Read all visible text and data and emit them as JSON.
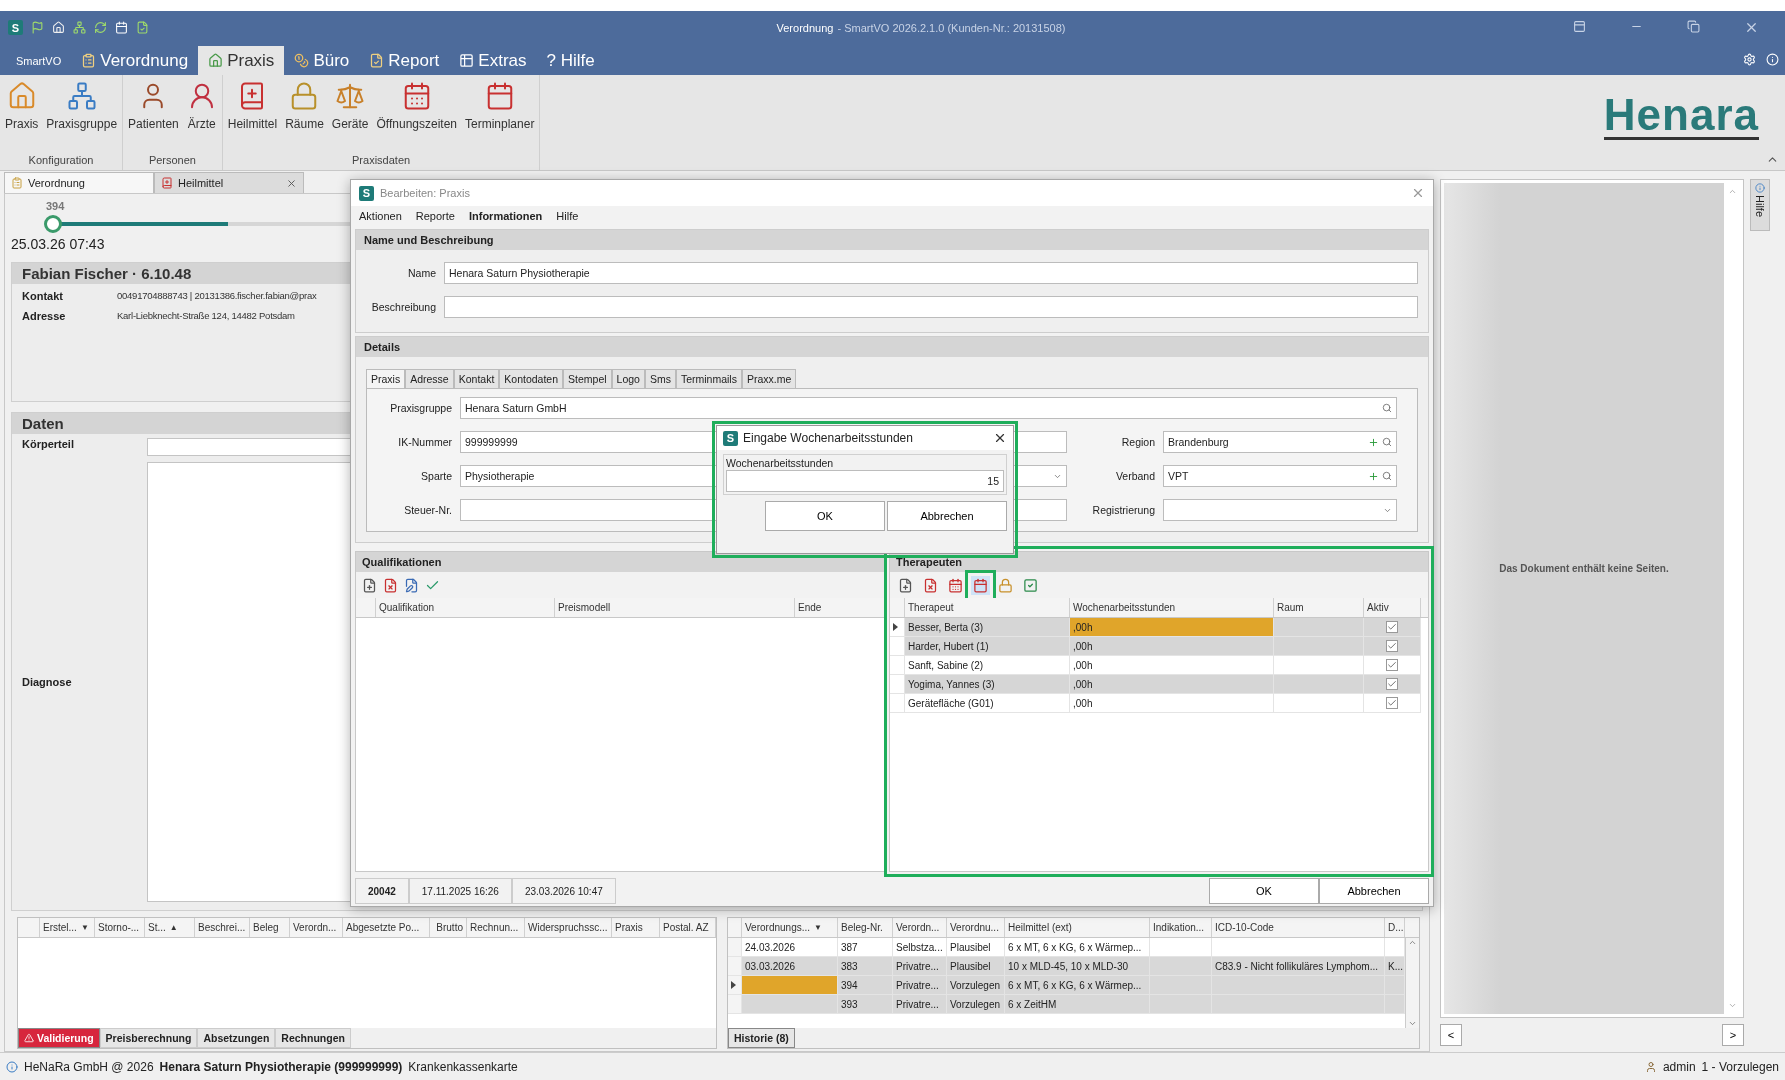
{
  "titlebar": {
    "app_badge": "S",
    "title": "Verordnung",
    "subtitle": "- SmartVO 2026.2.1.0 (Kunden-Nr.: 20131508)"
  },
  "ribbon": {
    "tabs": [
      {
        "label": "SmartVO",
        "selected": false
      },
      {
        "label": "Verordnung",
        "selected": false
      },
      {
        "label": "Praxis",
        "selected": true
      },
      {
        "label": "Büro",
        "selected": false
      },
      {
        "label": "Report",
        "selected": false
      },
      {
        "label": "Extras",
        "selected": false
      },
      {
        "label": "? Hilfe",
        "selected": false
      }
    ],
    "groups": [
      {
        "label": "Konfiguration",
        "items": [
          {
            "label": "Praxis"
          },
          {
            "label": "Praxisgruppe"
          }
        ]
      },
      {
        "label": "Personen",
        "items": [
          {
            "label": "Patienten"
          },
          {
            "label": "Ärzte"
          }
        ]
      },
      {
        "label": "Praxisdaten",
        "items": [
          {
            "label": "Heilmittel"
          },
          {
            "label": "Räume"
          },
          {
            "label": "Geräte"
          },
          {
            "label": "Öffnungszeiten"
          },
          {
            "label": "Terminplaner"
          }
        ]
      }
    ],
    "logo": "Henara"
  },
  "doc_tabs": [
    {
      "label": "Verordnung",
      "selected": true,
      "closable": false
    },
    {
      "label": "Heilmittel",
      "selected": false,
      "closable": true
    }
  ],
  "timeline": {
    "label": "394",
    "level": 0.42,
    "date": "25.03.26 07:43"
  },
  "patient": {
    "title": "Fabian Fischer · 6.10.48",
    "fields": [
      {
        "label": "Kontakt",
        "value": "00491704888743 | 20131386.fischer.fabian@prax"
      },
      {
        "label": "Adresse",
        "value": "Karl-Liebknecht-Straße 124,  14482 Potsdam"
      }
    ]
  },
  "daten": {
    "title": "Daten",
    "fields": [
      {
        "label": "Körperteil"
      },
      {
        "label": "Diagnose"
      }
    ]
  },
  "bottom_left": {
    "columns": [
      {
        "label": "Erstel...",
        "sort_mark": "▼"
      },
      {
        "label": "Storno-..."
      },
      {
        "label": "St...",
        "sort_mark": "▲"
      },
      {
        "label": "Beschrei..."
      },
      {
        "label": "Beleg"
      },
      {
        "label": "Verordn..."
      },
      {
        "label": "Abgesetzte Po..."
      },
      {
        "label": "Brutto"
      },
      {
        "label": "Rechnun..."
      },
      {
        "label": "Widerspruchssc..."
      },
      {
        "label": "Praxis"
      },
      {
        "label": "Postal. AZ"
      }
    ],
    "tabs": [
      {
        "label": "Validierung",
        "kind": "alert",
        "selected": true
      },
      {
        "label": "Preisberechnung",
        "kind": "normal",
        "selected": false
      },
      {
        "label": "Absetzungen",
        "kind": "normal",
        "selected": false
      },
      {
        "label": "Rechnungen",
        "kind": "normal",
        "selected": false
      }
    ]
  },
  "bottom_right": {
    "columns": [
      {
        "label": "Verordnungs...",
        "sort_mark": "▼"
      },
      {
        "label": "Beleg-Nr."
      },
      {
        "label": "Verordn..."
      },
      {
        "label": "Verordnu..."
      },
      {
        "label": "Heilmittel (ext)"
      },
      {
        "label": "Indikation..."
      },
      {
        "label": "ICD-10-Code"
      },
      {
        "label": "D..."
      }
    ],
    "rows": [
      {
        "cells": [
          "24.03.2026",
          "387",
          "Selbstza...",
          "Plausibel",
          "6 x MT, 6 x KG, 6 x Wärmep...",
          "",
          "",
          ""
        ],
        "selected": false,
        "shaded": false
      },
      {
        "cells": [
          "03.03.2026",
          "383",
          "Privatre...",
          "Plausibel",
          "10 x MLD-45, 10 x MLD-30",
          "",
          "C83.9 - Nicht follikuläres Lymphom...",
          "K..."
        ],
        "selected": false,
        "shaded": true
      },
      {
        "cells": [
          "",
          "394",
          "Privatre...",
          "Vorzulegen",
          "6 x MT, 6 x KG, 6 x Wärmep...",
          "",
          "",
          ""
        ],
        "selected": true,
        "shaded": true
      },
      {
        "cells": [
          "",
          "393",
          "Privatre...",
          "Vorzulegen",
          "6 x ZeitHM",
          "",
          "",
          ""
        ],
        "selected": false,
        "shaded": true
      }
    ],
    "tabs": [
      {
        "label": "Historie (8)",
        "selected": true
      }
    ]
  },
  "viewer": {
    "message": "Das Dokument enthält keine Seiten.",
    "prev": "<",
    "next": ">"
  },
  "side_tab": {
    "label": "Hilfe"
  },
  "status_bar": {
    "company": "HeNaRa GmbH @ 2026",
    "practice": "Henara Saturn Physiotherapie (999999999)",
    "card": "Krankenkassenkarte",
    "user": "admin",
    "queue": "1 - Vorzulegen"
  },
  "dialog": {
    "badge": "S",
    "title": "Bearbeiten: Praxis",
    "menu": [
      {
        "label": "Aktionen",
        "selected": false
      },
      {
        "label": "Reporte",
        "selected": false
      },
      {
        "label": "Informationen",
        "selected": true
      },
      {
        "label": "Hilfe",
        "selected": false
      }
    ],
    "name_section": {
      "title": "Name und Beschreibung",
      "name_label": "Name",
      "name_value": "Henara Saturn Physiotherapie",
      "description_label": "Beschreibung"
    },
    "details": {
      "title": "Details",
      "tabs": [
        {
          "label": "Praxis",
          "selected": true
        },
        {
          "label": "Adresse",
          "selected": false
        },
        {
          "label": "Kontakt",
          "selected": false
        },
        {
          "label": "Kontodaten",
          "selected": false
        },
        {
          "label": "Stempel",
          "selected": false
        },
        {
          "label": "Logo",
          "selected": false
        },
        {
          "label": "Sms",
          "selected": false
        },
        {
          "label": "Terminmails",
          "selected": false
        },
        {
          "label": "Praxx.me",
          "selected": false
        }
      ],
      "praxisgruppe": {
        "label": "Praxisgruppe",
        "value": "Henara Saturn GmbH"
      },
      "ik": {
        "label": "IK-Nummer",
        "value": "999999999"
      },
      "region": {
        "label": "Region",
        "value": "Brandenburg"
      },
      "sparte": {
        "label": "Sparte",
        "value": "Physiotherapie"
      },
      "verband": {
        "label": "Verband",
        "value": "VPT"
      },
      "steuer": {
        "label": "Steuer-Nr."
      },
      "registrierung": {
        "label": "Registrierung"
      }
    },
    "qualifikationen": {
      "title": "Qualifikationen",
      "columns": [
        "Qualifikation",
        "Preismodell",
        "Ende"
      ]
    },
    "therapeuten": {
      "title": "Therapeuten",
      "highlighted": true,
      "toolbar": [
        {
          "highlighted": false
        },
        {
          "highlighted": false
        },
        {
          "highlighted": false
        },
        {
          "highlighted": true
        },
        {
          "highlighted": false
        },
        {
          "highlighted": false
        }
      ],
      "columns": [
        "Therapeut",
        "Wochenarbeitsstunden",
        "Raum",
        "Aktiv"
      ],
      "rows": [
        {
          "name": "Besser, Berta (3)",
          "hours": ",00h",
          "checked": true,
          "selected": true,
          "shaded": true
        },
        {
          "name": "Harder, Hubert (1)",
          "hours": ",00h",
          "checked": true,
          "selected": false,
          "shaded": true
        },
        {
          "name": "Sanft, Sabine (2)",
          "hours": ",00h",
          "checked": true,
          "selected": false,
          "shaded": false
        },
        {
          "name": "Yogima, Yannes (3)",
          "hours": ",00h",
          "checked": true,
          "selected": false,
          "shaded": true
        },
        {
          "name": "Gerätefläche (G01)",
          "hours": ",00h",
          "checked": true,
          "selected": false,
          "shaded": false
        }
      ]
    },
    "footer": {
      "id": "20042",
      "created": "17.11.2025 16:26",
      "modified": "23.03.2026 10:47",
      "ok": "OK",
      "cancel": "Abbrechen"
    }
  },
  "input_dialog": {
    "badge": "S",
    "title": "Eingabe Wochenarbeitsstunden",
    "highlighted": true,
    "field_label": "Wochenarbeitsstunden",
    "value": "15",
    "ok": "OK",
    "cancel": "Abbrechen"
  }
}
